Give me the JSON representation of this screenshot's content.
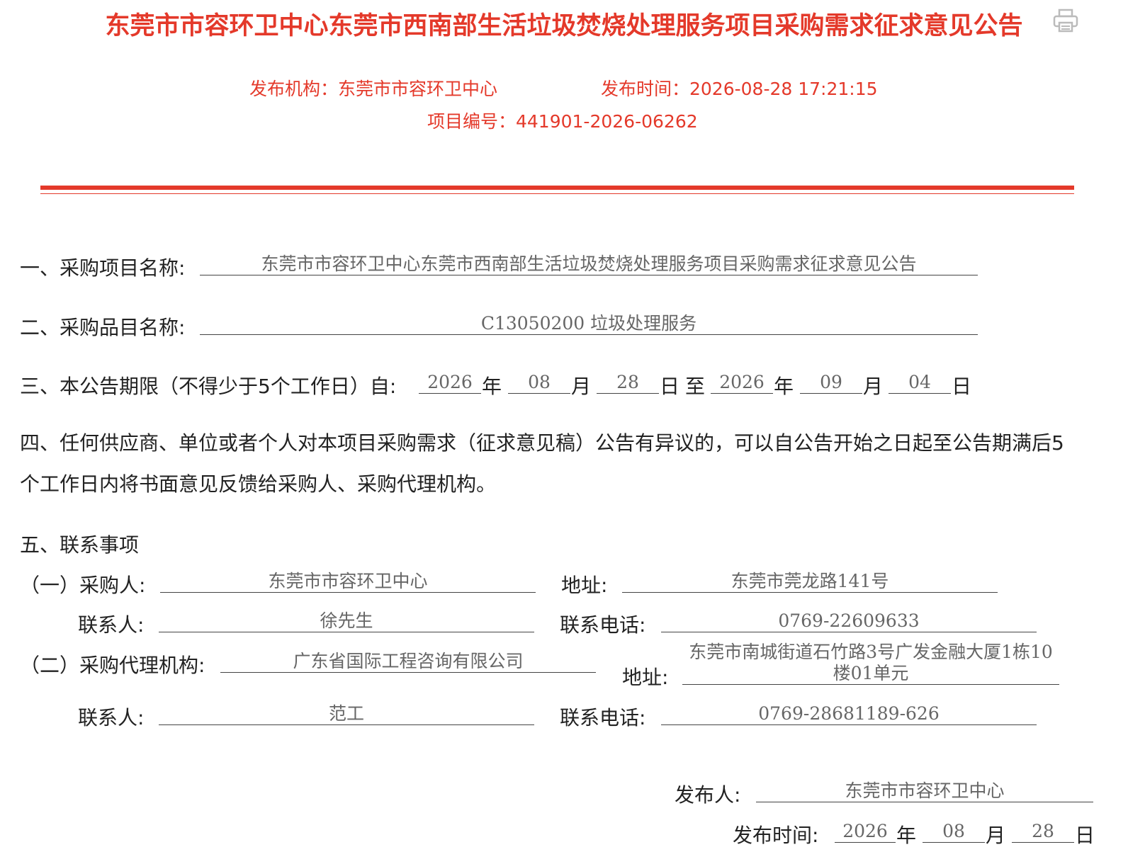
{
  "header": {
    "title": "东莞市市容环卫中心东莞市西南部生活垃圾焚烧处理服务项目采购需求征求意见公告",
    "print_icon": "printer-icon",
    "publisher_label": "发布机构：东莞市市容环卫中心",
    "publish_time_label": "发布时间：2026-08-28 17:21:15",
    "project_no_label": "项目编号：441901-2026-06262"
  },
  "colors": {
    "accent": "#e4392a"
  },
  "section1": {
    "label": "一、采购项目名称:",
    "value": "东莞市市容环卫中心东莞市西南部生活垃圾焚烧处理服务项目采购需求征求意见公告"
  },
  "section2": {
    "label": "二、采购品目名称:",
    "value": "C13050200 垃圾处理服务"
  },
  "section3": {
    "label": "三、本公告期限（不得少于5个工作日）自:",
    "start_year": "2026",
    "start_month": "08",
    "start_day": "28",
    "end_year": "2026",
    "end_month": "09",
    "end_day": "04",
    "year_char": "年",
    "month_char": "月",
    "day_char": "日",
    "to_char": "至"
  },
  "section4": {
    "text": "四、任何供应商、单位或者个人对本项目采购需求（征求意见稿）公告有异议的，可以自公告开始之日起至公告期满后5个工作日内将书面意见反馈给采购人、采购代理机构。"
  },
  "section5": {
    "heading": "五、联系事项",
    "purchaser_label": "（一）采购人:",
    "purchaser": "东莞市市容环卫中心",
    "purchaser_address_label": "地址:",
    "purchaser_address": "东莞市莞龙路141号",
    "purchaser_contact_label": "联系人:",
    "purchaser_contact": "徐先生",
    "purchaser_phone_label": "联系电话:",
    "purchaser_phone": "0769-22609633",
    "agency_label": "（二）采购代理机构:",
    "agency": "广东省国际工程咨询有限公司",
    "agency_address_label": "地址:",
    "agency_address": "东莞市南城街道石竹路3号广发金融大厦1栋10楼01单元",
    "agency_contact_label": "联系人:",
    "agency_contact": "范工",
    "agency_phone_label": "联系电话:",
    "agency_phone": "0769-28681189-626"
  },
  "footer": {
    "issuer_label": "发布人:",
    "issuer": "东莞市市容环卫中心",
    "date_label": "发布时间:",
    "year": "2026",
    "month": "08",
    "day": "28",
    "year_char": "年",
    "month_char": "月",
    "day_char": "日"
  }
}
